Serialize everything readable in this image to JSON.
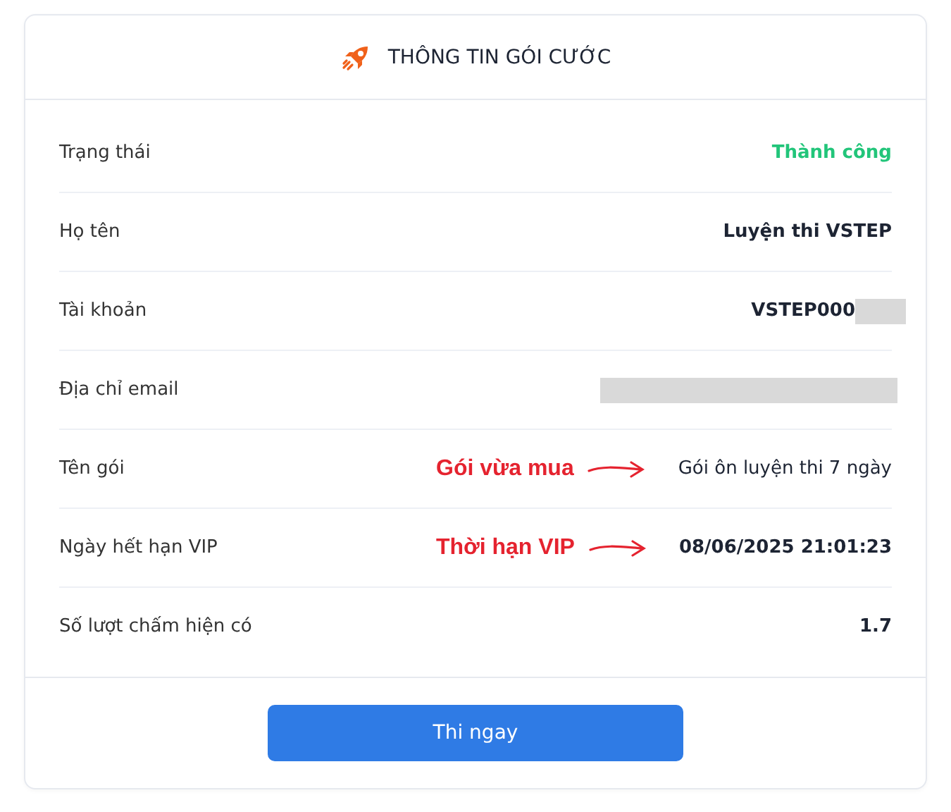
{
  "header": {
    "title": "THÔNG TIN GÓI CƯỚC"
  },
  "rows": [
    {
      "label": "Trạng thái",
      "value": "Thành công",
      "kind": "success"
    },
    {
      "label": "Họ tên",
      "value": "Luyện thi VSTEP",
      "kind": "bold"
    },
    {
      "label": "Tài khoản",
      "value": "VSTEP000",
      "kind": "bold",
      "redacted": true
    },
    {
      "label": "Địa chỉ email",
      "redacted": true
    },
    {
      "label": "Tên gói",
      "value": "Gói ôn luyện thi 7 ngày",
      "kind": "plain",
      "annotation": "Gói vừa mua"
    },
    {
      "label": "Ngày hết hạn VIP",
      "value": "08/06/2025 21:01:23",
      "kind": "bold",
      "annotation": "Thời hạn VIP"
    },
    {
      "label": "Số lượt chấm hiện có",
      "value": "1.7",
      "kind": "bold"
    }
  ],
  "button": "Thi ngay"
}
